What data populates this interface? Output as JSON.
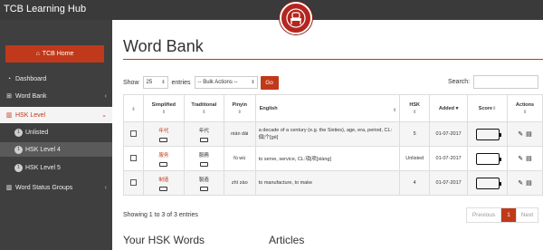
{
  "app": {
    "title": "TCB Learning Hub"
  },
  "sidebar": {
    "home_label": "TCB Home",
    "items": [
      {
        "label": "Dashboard"
      },
      {
        "label": "Word Bank"
      },
      {
        "label": "HSK Level"
      },
      {
        "label": "Word Status Groups"
      }
    ],
    "sub_items": [
      {
        "badge": "1",
        "label": "Unlisted"
      },
      {
        "badge": "1",
        "label": "HSK Level 4"
      },
      {
        "badge": "1",
        "label": "HSK Level 5"
      }
    ]
  },
  "main": {
    "title": "Word Bank",
    "show_label": "Show",
    "entries_value": "25",
    "entries_label": "entries",
    "bulk_actions": "-- Bulk Actions --",
    "go_label": "Go",
    "search_label": "Search:",
    "search_value": ""
  },
  "table": {
    "headers": [
      "Simplified",
      "Traditional",
      "Pinyin",
      "English",
      "HSK",
      "Added",
      "Score",
      "Actions"
    ],
    "rows": [
      {
        "simplified": "年代",
        "traditional": "年代",
        "pinyin": "nián dài",
        "english": "a decade of a century (e.g. the Sixties), age, era, period, CL:個|个[gè]",
        "hsk": "5",
        "added": "01-07-2017"
      },
      {
        "simplified": "服务",
        "traditional": "服務",
        "pinyin": "fú wù",
        "english": "to serve, service, CL:項|项[xiàng]",
        "hsk": "Unlisted",
        "added": "01-07-2017"
      },
      {
        "simplified": "制造",
        "traditional": "製造",
        "pinyin": "zhì zào",
        "english": "to manufacture, to make",
        "hsk": "4",
        "added": "01-07-2017"
      }
    ]
  },
  "footer": {
    "info": "Showing 1 to 3 of 3 entries",
    "prev": "Previous",
    "page": "1",
    "next": "Next"
  },
  "sections": {
    "left": "Your HSK Words",
    "right": "Articles"
  },
  "colors": {
    "accent": "#c0391b",
    "sidebar": "#3f3f3f",
    "topbar": "#3a3a3a"
  }
}
